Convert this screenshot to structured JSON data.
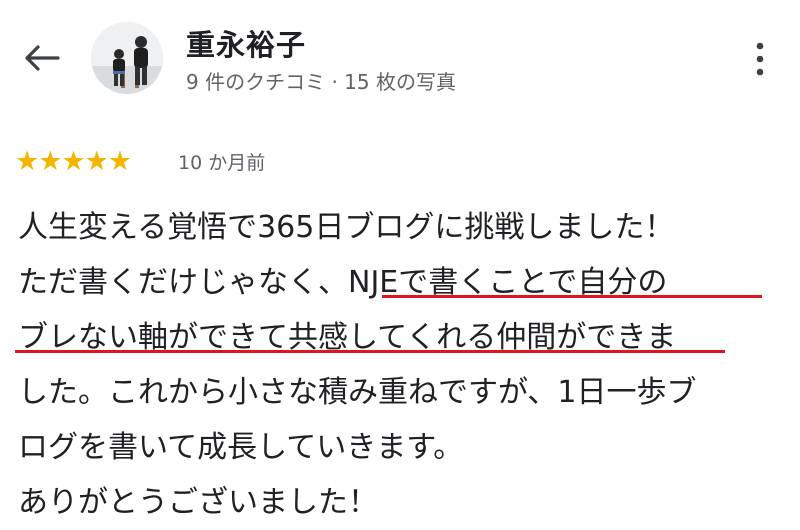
{
  "header": {
    "reviewer_name": "重永裕子",
    "reviewer_meta": "9 件のクチコミ · 15 枚の写真"
  },
  "review": {
    "rating": 5,
    "rating_max": 5,
    "stars": "★★★★★",
    "time": "10 か月前",
    "lines": [
      "人生変える覚悟で365日ブログに挑戦しました！",
      "ただ書くだけじゃなく、NJEで書くことで自分の",
      "ブレない軸ができて共感してくれる仲間ができま",
      "した。これから小さな積み重ねですが、1日一歩ブ",
      "ログを書いて成長していきます。",
      "ありがとうございました！"
    ]
  },
  "colors": {
    "star": "#f4b400",
    "underline": "#e0141e",
    "text": "#202124",
    "secondary_text": "#5f6368"
  },
  "icons": {
    "back": "back-arrow-icon",
    "more": "more-vertical-icon",
    "avatar": "reviewer-avatar"
  }
}
